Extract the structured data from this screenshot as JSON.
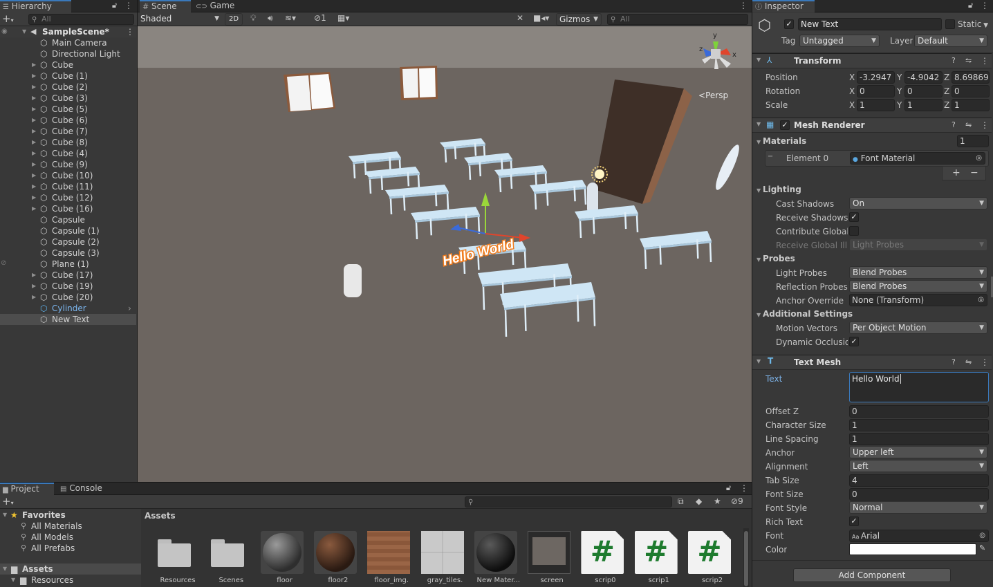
{
  "hierarchy": {
    "tab_label": "Hierarchy",
    "search_placeholder": "All",
    "scene_name": "SampleScene*",
    "items": [
      {
        "label": "Main Camera",
        "has_children": false,
        "depth": 1
      },
      {
        "label": "Directional Light",
        "has_children": false,
        "depth": 1
      },
      {
        "label": "Cube",
        "has_children": true,
        "depth": 1
      },
      {
        "label": "Cube (1)",
        "has_children": true,
        "depth": 1
      },
      {
        "label": "Cube (2)",
        "has_children": true,
        "depth": 1
      },
      {
        "label": "Cube (3)",
        "has_children": true,
        "depth": 1
      },
      {
        "label": "Cube (5)",
        "has_children": true,
        "depth": 1
      },
      {
        "label": "Cube (6)",
        "has_children": true,
        "depth": 1
      },
      {
        "label": "Cube (7)",
        "has_children": true,
        "depth": 1
      },
      {
        "label": "Cube (8)",
        "has_children": true,
        "depth": 1
      },
      {
        "label": "Cube (4)",
        "has_children": true,
        "depth": 1
      },
      {
        "label": "Cube (9)",
        "has_children": true,
        "depth": 1
      },
      {
        "label": "Cube (10)",
        "has_children": true,
        "depth": 1
      },
      {
        "label": "Cube (11)",
        "has_children": true,
        "depth": 1
      },
      {
        "label": "Cube (12)",
        "has_children": true,
        "depth": 1
      },
      {
        "label": "Cube (16)",
        "has_children": true,
        "depth": 1
      },
      {
        "label": "Capsule",
        "has_children": false,
        "depth": 1
      },
      {
        "label": "Capsule (1)",
        "has_children": false,
        "depth": 1
      },
      {
        "label": "Capsule (2)",
        "has_children": false,
        "depth": 1
      },
      {
        "label": "Capsule (3)",
        "has_children": false,
        "depth": 1
      },
      {
        "label": "Plane (1)",
        "has_children": false,
        "depth": 1
      },
      {
        "label": "Cube (17)",
        "has_children": true,
        "depth": 1
      },
      {
        "label": "Cube (19)",
        "has_children": true,
        "depth": 1
      },
      {
        "label": "Cube (20)",
        "has_children": true,
        "depth": 1
      },
      {
        "label": "Cylinder",
        "has_children": false,
        "depth": 1,
        "prefab": true
      },
      {
        "label": "New Text",
        "has_children": false,
        "depth": 1,
        "selected": true
      }
    ]
  },
  "scene": {
    "tab_scene": "Scene",
    "tab_game": "Game",
    "shading_mode": "Shaded",
    "toggle_2d": "2D",
    "gizmo_count": "1",
    "gizmos_label": "Gizmos",
    "search_placeholder": "All",
    "persp_label": "Persp",
    "axis_x": "x",
    "axis_y": "y",
    "axis_z": "z",
    "hello_text": "Hello World"
  },
  "project": {
    "tab_project": "Project",
    "tab_console": "Console",
    "hidden_count": "9",
    "favorites_label": "Favorites",
    "favorites": [
      "All Materials",
      "All Models",
      "All Prefabs"
    ],
    "assets_label": "Assets",
    "asset_folders": [
      "Resources"
    ],
    "breadcrumb": "Assets",
    "assets": [
      {
        "label": "Resources",
        "kind": "folder"
      },
      {
        "label": "Scenes",
        "kind": "folder"
      },
      {
        "label": "floor",
        "kind": "sphere-gray"
      },
      {
        "label": "floor2",
        "kind": "sphere-brown"
      },
      {
        "label": "floor_img.",
        "kind": "texture-wood"
      },
      {
        "label": "gray_tiles.",
        "kind": "texture-tiles"
      },
      {
        "label": "New Mater...",
        "kind": "sphere-dark"
      },
      {
        "label": "screen",
        "kind": "render"
      },
      {
        "label": "scrip0",
        "kind": "script"
      },
      {
        "label": "scrip1",
        "kind": "script"
      },
      {
        "label": "scrip2",
        "kind": "script"
      }
    ]
  },
  "inspector": {
    "tab_label": "Inspector",
    "object_name": "New Text",
    "static_label": "Static",
    "tag_label": "Tag",
    "tag_value": "Untagged",
    "layer_label": "Layer",
    "layer_value": "Default",
    "transform": {
      "title": "Transform",
      "rows": [
        {
          "label": "Position",
          "x": "-3.2947",
          "y": "-4.9042",
          "z": "8.69869;"
        },
        {
          "label": "Rotation",
          "x": "0",
          "y": "0",
          "z": "0"
        },
        {
          "label": "Scale",
          "x": "1",
          "y": "1",
          "z": "1"
        }
      ]
    },
    "mesh_renderer": {
      "title": "Mesh Renderer",
      "materials_label": "Materials",
      "materials_count": "1",
      "element0_label": "Element 0",
      "element0_value": "Font Material",
      "lighting_label": "Lighting",
      "cast_shadows_label": "Cast Shadows",
      "cast_shadows_value": "On",
      "receive_shadows_label": "Receive Shadows",
      "contribute_gi_label": "Contribute Global I",
      "receive_gi_label": "Receive Global Illu",
      "receive_gi_value": "Light Probes",
      "probes_label": "Probes",
      "light_probes_label": "Light Probes",
      "light_probes_value": "Blend Probes",
      "reflection_probes_label": "Reflection Probes",
      "reflection_probes_value": "Blend Probes",
      "anchor_override_label": "Anchor Override",
      "anchor_override_value": "None (Transform)",
      "additional_label": "Additional Settings",
      "motion_vectors_label": "Motion Vectors",
      "motion_vectors_value": "Per Object Motion",
      "dynamic_occlusion_label": "Dynamic Occlusion"
    },
    "text_mesh": {
      "title": "Text Mesh",
      "text_label": "Text",
      "text_value": "Hello World",
      "offset_z_label": "Offset Z",
      "offset_z_value": "0",
      "char_size_label": "Character Size",
      "char_size_value": "1",
      "line_spacing_label": "Line Spacing",
      "line_spacing_value": "1",
      "anchor_label": "Anchor",
      "anchor_value": "Upper left",
      "alignment_label": "Alignment",
      "alignment_value": "Left",
      "tab_size_label": "Tab Size",
      "tab_size_value": "4",
      "font_size_label": "Font Size",
      "font_size_value": "0",
      "font_style_label": "Font Style",
      "font_style_value": "Normal",
      "rich_text_label": "Rich Text",
      "font_label": "Font",
      "font_value": "Arial",
      "color_label": "Color",
      "color_value": "#ffffff"
    },
    "add_component_label": "Add Component"
  }
}
